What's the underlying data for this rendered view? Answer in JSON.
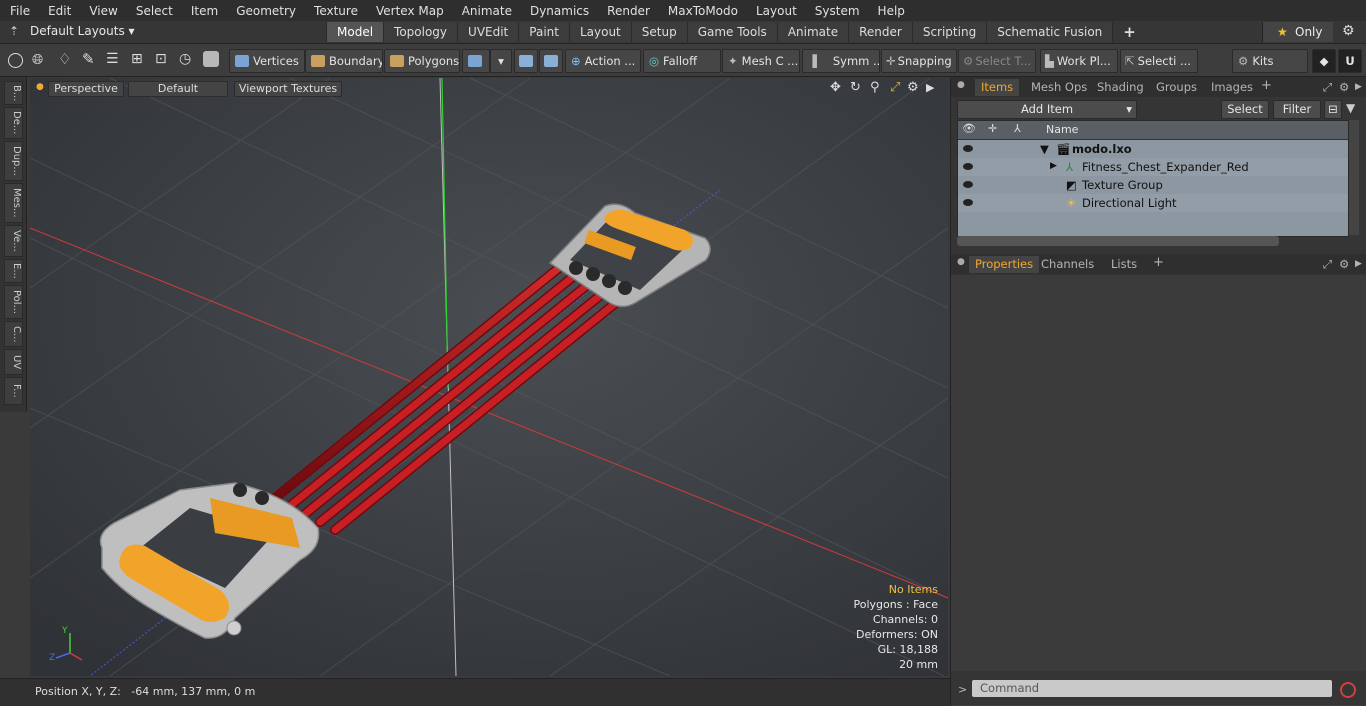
{
  "menu": [
    "File",
    "Edit",
    "View",
    "Select",
    "Item",
    "Geometry",
    "Texture",
    "Vertex Map",
    "Animate",
    "Dynamics",
    "Render",
    "MaxToModo",
    "Layout",
    "System",
    "Help"
  ],
  "layout": {
    "label": "Default Layouts ▾"
  },
  "tabs": [
    "Model",
    "Topology",
    "UVEdit",
    "Paint",
    "Layout",
    "Setup",
    "Game Tools",
    "Animate",
    "Render",
    "Scripting",
    "Schematic Fusion"
  ],
  "only_label": "Only",
  "toolbar": {
    "vertices": "Vertices",
    "boundary": "Boundary",
    "polygons": "Polygons",
    "action": "Action ...",
    "falloff": "Falloff",
    "mesh": "Mesh C ...",
    "symm": "Symm ...",
    "snapping": "Snapping",
    "select_t": "Select T...",
    "work_pl": "Work Pl...",
    "selecti": "Selecti ...",
    "kits": "Kits"
  },
  "left_tabs": [
    "B...",
    "De...",
    "Dup...",
    "Mes...",
    "Ve...",
    "E...",
    "Pol...",
    "C...",
    "UV",
    "F..."
  ],
  "viewport": {
    "perspective": "Perspective",
    "default": "Default",
    "textures": "Viewport Textures",
    "info": [
      "No Items",
      "Polygons : Face",
      "Channels: 0",
      "Deformers: ON",
      "GL: 18,188",
      "20 mm"
    ]
  },
  "status": {
    "position": "Position X, Y, Z:   -64 mm, 137 mm, 0 m"
  },
  "panel_tabs": [
    "Items",
    "Mesh Ops",
    "Shading",
    "Groups",
    "Images"
  ],
  "add_item": "Add Item",
  "select_btn": "Select",
  "filter_btn": "Filter",
  "col_name": "Name",
  "items": [
    {
      "name": "modo.lxo",
      "bold": true
    },
    {
      "name": "Fitness_Chest_Expander_Red",
      "bold": false
    },
    {
      "name": "Texture Group",
      "bold": false
    },
    {
      "name": "Directional Light",
      "bold": false
    }
  ],
  "prop_tabs": [
    "Properties",
    "Channels",
    "Lists"
  ],
  "command_placeholder": "Command",
  "colors": {
    "accent": "#f0a830",
    "cord": "#b3121a",
    "handle": "#f2a42a",
    "grip": "#bfbfbf"
  }
}
